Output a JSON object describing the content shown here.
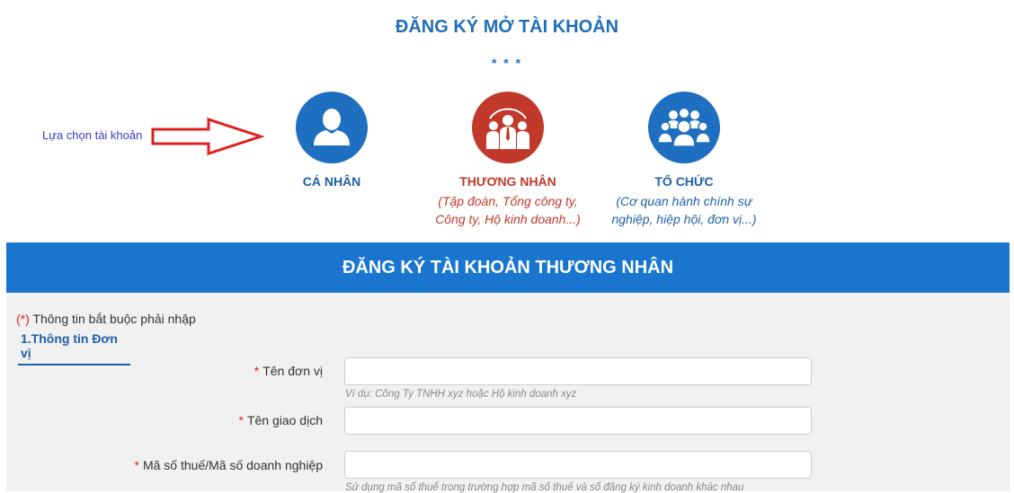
{
  "page": {
    "title": "ĐĂNG KÝ MỞ TÀI KHOẢN",
    "stars": "* * *",
    "choose_label": "Lựa chọn tài khoản"
  },
  "accounts": [
    {
      "name": "CÁ NHÂN",
      "desc_line1": "",
      "desc_line2": "",
      "icon": "person-icon",
      "color": "#1e6fc0"
    },
    {
      "name": "THƯƠNG NHÂN",
      "desc_line1": "(Tập đoàn, Tổng công ty,",
      "desc_line2": "Công ty, Hộ kinh doanh...)",
      "icon": "business-group-icon",
      "color": "#c0392b"
    },
    {
      "name": "TỐ CHỨC",
      "desc_line1": "(Cơ quan hành chính sự",
      "desc_line2": "nghiệp, hiệp hội, đơn vị...)",
      "icon": "people-group-icon",
      "color": "#1e6fc0"
    }
  ],
  "form": {
    "header": "ĐĂNG KÝ TÀI KHOẢN THƯƠNG NHÂN",
    "required_mark": "(*)",
    "required_note": " Thông tin bắt buộc phải nhập",
    "section_title": "1.Thông tin Đơn vị",
    "fields": [
      {
        "star": "*",
        "label": "Tên đơn vị",
        "value": "",
        "hint": "Ví dụ: Công Ty TNHH xyz hoặc Hộ kinh doanh xyz"
      },
      {
        "star": "*",
        "label": "Tên giao dịch",
        "value": "",
        "hint": ""
      },
      {
        "star": "*",
        "label": "Mã số thuế/Mã số doanh nghiệp",
        "value": "",
        "hint": "Sử dụng mã số thuế trong trường hợp mã số thuế và số đăng ký kinh doanh khác nhau"
      }
    ]
  }
}
